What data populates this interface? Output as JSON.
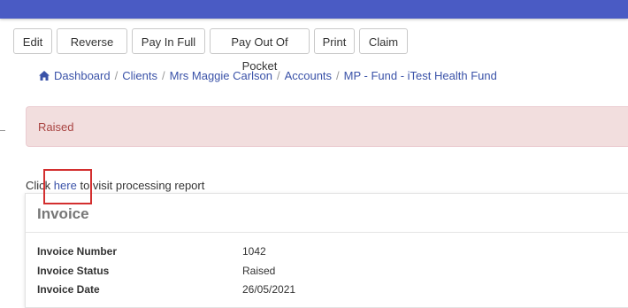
{
  "toolbar": {
    "buttons": [
      "Edit",
      "Reverse",
      "Pay In Full",
      "Pay Out Of Pocket",
      "Print",
      "Claim"
    ]
  },
  "breadcrumb": {
    "items": [
      "Dashboard",
      "Clients",
      "Mrs Maggie Carlson",
      "Accounts",
      "MP - Fund - iTest Health Fund"
    ]
  },
  "alert": {
    "text": "Raised"
  },
  "processing": {
    "prefix": "Click",
    "link": "here",
    "suffix": "to visit processing report"
  },
  "invoice": {
    "title": "Invoice",
    "fields": [
      {
        "label": "Invoice Number",
        "value": "1042"
      },
      {
        "label": "Invoice Status",
        "value": "Raised"
      },
      {
        "label": "Invoice Date",
        "value": "26/05/2021"
      }
    ]
  },
  "colors": {
    "topbar": "#4a5bc4",
    "link": "#3a52a8",
    "alert_bg": "#f2dede",
    "alert_text": "#a94442",
    "highlight": "#d32f2f"
  }
}
